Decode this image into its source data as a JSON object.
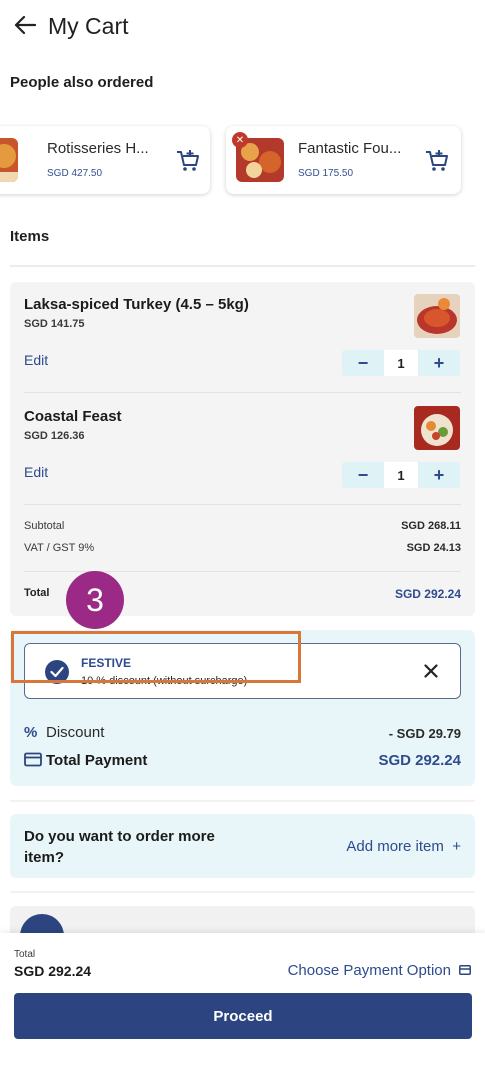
{
  "header": {
    "title": "My Cart"
  },
  "recommendations": {
    "title": "People also ordered",
    "items": [
      {
        "name": "Rotisseries H...",
        "price": "SGD 427.50"
      },
      {
        "name": "Fantastic Fou...",
        "price": "SGD 175.50"
      }
    ]
  },
  "items_section": {
    "title": "Items",
    "items": [
      {
        "name": "Laksa-spiced Turkey (4.5 – 5kg)",
        "price": "SGD 141.75",
        "edit_label": "Edit",
        "quantity": "1"
      },
      {
        "name": "Coastal Feast",
        "price": "SGD 126.36",
        "edit_label": "Edit",
        "quantity": "1"
      }
    ],
    "summary": {
      "subtotal_label": "Subtotal",
      "subtotal_value": "SGD 268.11",
      "vat_label": "VAT / GST 9%",
      "vat_value": "SGD 24.13",
      "total_label": "Total",
      "total_value": "SGD 292.24"
    }
  },
  "step_badge": "3",
  "promo": {
    "code": "FESTIVE",
    "description": "10 % discount (without surcharge)",
    "discount_label": "Discount",
    "discount_value": "- SGD 29.79",
    "total_payment_label": "Total Payment",
    "total_payment_value": "SGD 292.24"
  },
  "more": {
    "question": "Do you want to order more item?",
    "add_label": "Add more item"
  },
  "footer": {
    "total_label": "Total",
    "total_value": "SGD 292.24",
    "choose_payment_label": "Choose Payment Option",
    "proceed_label": "Proceed"
  },
  "colors": {
    "brand_blue": "#2c4580",
    "link_blue": "#2d4b8e",
    "promo_bg": "#e8f6f9",
    "highlight_orange": "#d9763a",
    "badge_purple": "#9a2a86"
  }
}
